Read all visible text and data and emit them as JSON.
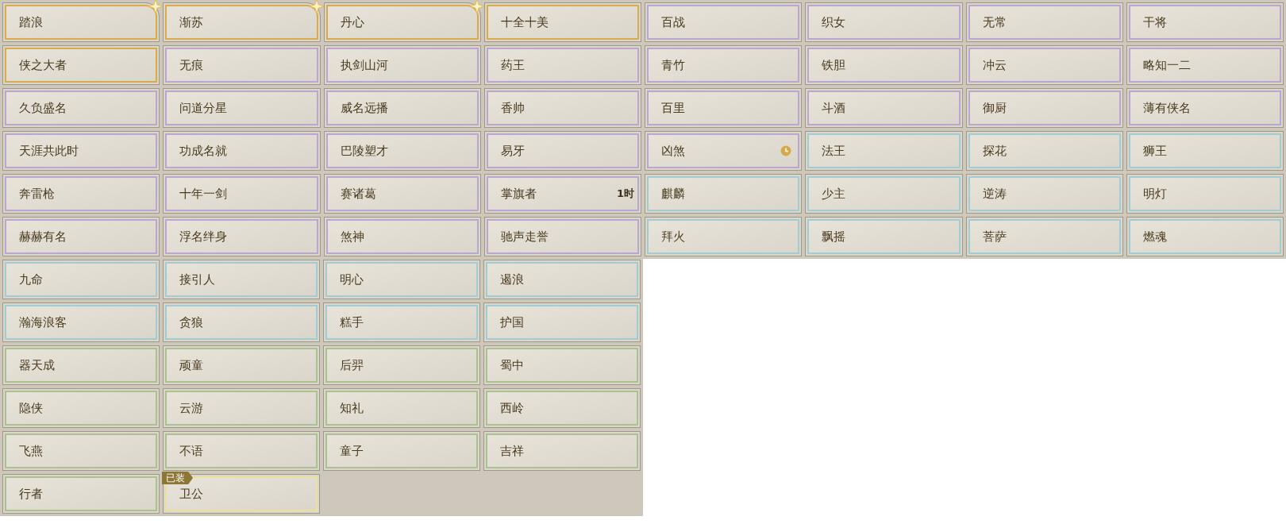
{
  "upper_grid": [
    {
      "name": "踏浪",
      "color": "#d9ab4e",
      "sparkle": true
    },
    {
      "name": "渐苏",
      "color": "#d9ab4e",
      "sparkle": true
    },
    {
      "name": "丹心",
      "color": "#d9ab4e",
      "sparkle": true
    },
    {
      "name": "十全十美",
      "color": "#d9ab4e"
    },
    {
      "name": "百战",
      "color": "#bba6d2"
    },
    {
      "name": "织女",
      "color": "#bba6d2"
    },
    {
      "name": "无常",
      "color": "#bba6d2"
    },
    {
      "name": "干将",
      "color": "#bba6d2"
    },
    {
      "name": "侠之大者",
      "color": "#d9ab4e"
    },
    {
      "name": "无痕",
      "color": "#bba6d2"
    },
    {
      "name": "执剑山河",
      "color": "#bba6d2"
    },
    {
      "name": "药王",
      "color": "#bba6d2"
    },
    {
      "name": "青竹",
      "color": "#bba6d2"
    },
    {
      "name": "铁胆",
      "color": "#bba6d2"
    },
    {
      "name": "冲云",
      "color": "#bba6d2"
    },
    {
      "name": "略知一二",
      "color": "#bba6d2"
    },
    {
      "name": "久负盛名",
      "color": "#bba6d2"
    },
    {
      "name": "问道分星",
      "color": "#bba6d2"
    },
    {
      "name": "威名远播",
      "color": "#bba6d2"
    },
    {
      "name": "香帅",
      "color": "#bba6d2"
    },
    {
      "name": "百里",
      "color": "#bba6d2"
    },
    {
      "name": "斗酒",
      "color": "#bba6d2"
    },
    {
      "name": "御厨",
      "color": "#bba6d2"
    },
    {
      "name": "薄有侠名",
      "color": "#bba6d2"
    },
    {
      "name": "天涯共此时",
      "color": "#bba6d2"
    },
    {
      "name": "功成名就",
      "color": "#bba6d2"
    },
    {
      "name": "巴陵塑才",
      "color": "#bba6d2"
    },
    {
      "name": "易牙",
      "color": "#bba6d2"
    },
    {
      "name": "凶煞",
      "color": "#bba6d2",
      "clock": true
    },
    {
      "name": "法王",
      "color": "#a3cbd3"
    },
    {
      "name": "探花",
      "color": "#a3cbd3"
    },
    {
      "name": "狮王",
      "color": "#a3cbd3"
    },
    {
      "name": "奔雷枪",
      "color": "#bba6d2"
    },
    {
      "name": "十年一剑",
      "color": "#bba6d2"
    },
    {
      "name": "赛诸葛",
      "color": "#bba6d2"
    },
    {
      "name": "掌旗者",
      "color": "#bba6d2",
      "timer": "1时"
    },
    {
      "name": "麒麟",
      "color": "#a3cbd3"
    },
    {
      "name": "少主",
      "color": "#a3cbd3"
    },
    {
      "name": "逆涛",
      "color": "#a3cbd3"
    },
    {
      "name": "明灯",
      "color": "#a3cbd3"
    },
    {
      "name": "赫赫有名",
      "color": "#bba6d2"
    },
    {
      "name": "浮名绊身",
      "color": "#bba6d2"
    },
    {
      "name": "煞神",
      "color": "#bba6d2"
    },
    {
      "name": "驰声走誉",
      "color": "#bba6d2"
    },
    {
      "name": "拜火",
      "color": "#a3cbd3"
    },
    {
      "name": "飘摇",
      "color": "#a3cbd3"
    },
    {
      "name": "菩萨",
      "color": "#a3cbd3"
    },
    {
      "name": "燃魂",
      "color": "#a3cbd3"
    }
  ],
  "lower_grid": [
    {
      "name": "九命",
      "color": "#a3cbd3"
    },
    {
      "name": "接引人",
      "color": "#a3cbd3"
    },
    {
      "name": "明心",
      "color": "#a3cbd3"
    },
    {
      "name": "遏浪",
      "color": "#a3cbd3"
    },
    {
      "name": "瀚海浪客",
      "color": "#a3cbd3"
    },
    {
      "name": "贪狼",
      "color": "#a3cbd3"
    },
    {
      "name": "糕手",
      "color": "#a3cbd3"
    },
    {
      "name": "护国",
      "color": "#a3cbd3"
    },
    {
      "name": "器天成",
      "color": "#abc290"
    },
    {
      "name": "顽童",
      "color": "#abc290"
    },
    {
      "name": "后羿",
      "color": "#abc290"
    },
    {
      "name": "蜀中",
      "color": "#abc290"
    },
    {
      "name": "隐侠",
      "color": "#abc290"
    },
    {
      "name": "云游",
      "color": "#abc290"
    },
    {
      "name": "知礼",
      "color": "#abc290"
    },
    {
      "name": "西岭",
      "color": "#abc290"
    },
    {
      "name": "飞燕",
      "color": "#abc290"
    },
    {
      "name": "不语",
      "color": "#abc290"
    },
    {
      "name": "童子",
      "color": "#abc290"
    },
    {
      "name": "吉祥",
      "color": "#abc290"
    },
    {
      "name": "行者",
      "color": "#abc290"
    },
    {
      "name": "卫公",
      "color": "#ece0a0",
      "equipped_tag": "已装"
    }
  ]
}
